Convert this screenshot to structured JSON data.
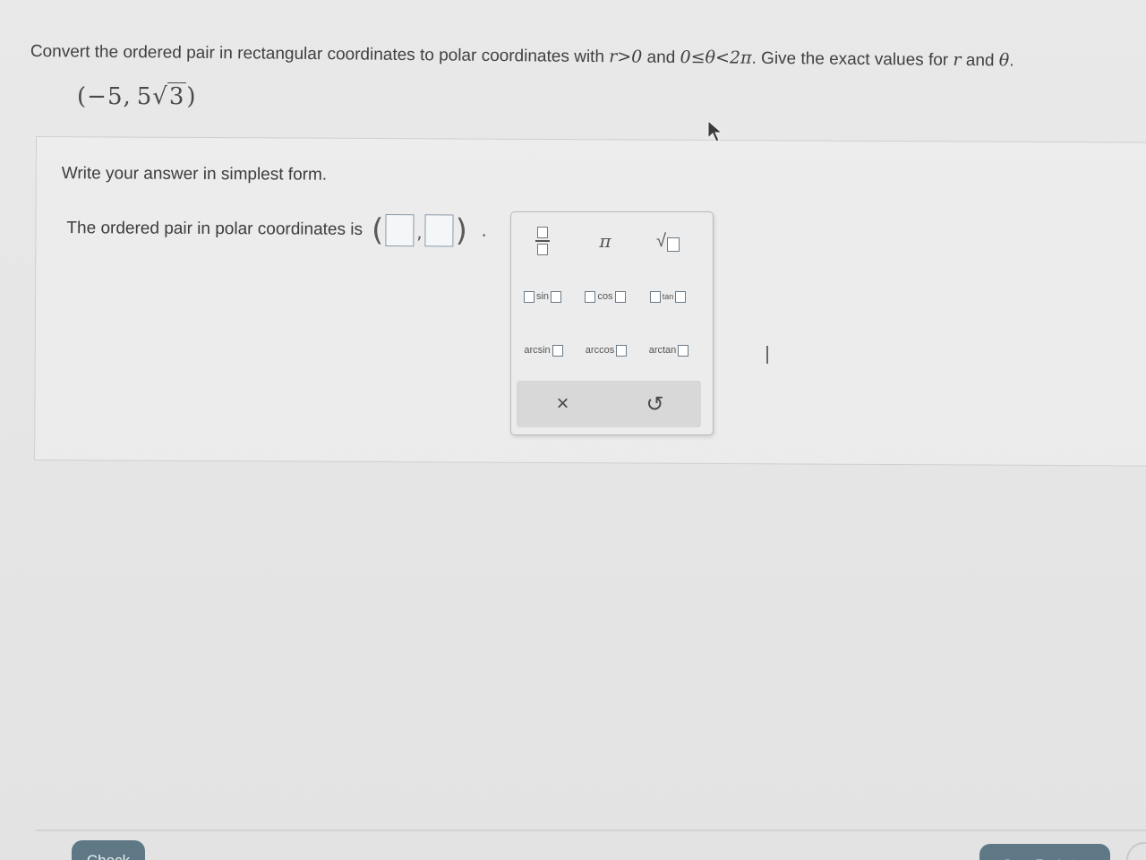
{
  "question": {
    "prompt_pre": "Convert the ordered pair in rectangular coordinates to polar coordinates with ",
    "cond_r": "r>0",
    "prompt_and": " and ",
    "cond_theta": "0≤θ<2π",
    "prompt_post": ". Give the exact values for ",
    "var_r": "r",
    "var_theta": "θ",
    "period": ".",
    "given_open": "(",
    "given_x": "−5,",
    "given_coef": "5",
    "given_radical": "√",
    "given_radicand": "3",
    "given_close": ")"
  },
  "answer": {
    "instruction": "Write your answer in simplest form.",
    "label": "The ordered pair in polar coordinates is",
    "open_paren": "(",
    "comma": ",",
    "close_paren": ")",
    "period": "."
  },
  "keypad": {
    "pi": "π",
    "sqrt_symbol": "√",
    "sin": "sin",
    "cos": "cos",
    "tan": "tan",
    "arcsin": "arcsin",
    "arccos": "arccos",
    "arctan": "arctan",
    "clear": "×",
    "undo": "↺"
  },
  "footer": {
    "check_label": "Check",
    "save_label": "Save For Later"
  }
}
